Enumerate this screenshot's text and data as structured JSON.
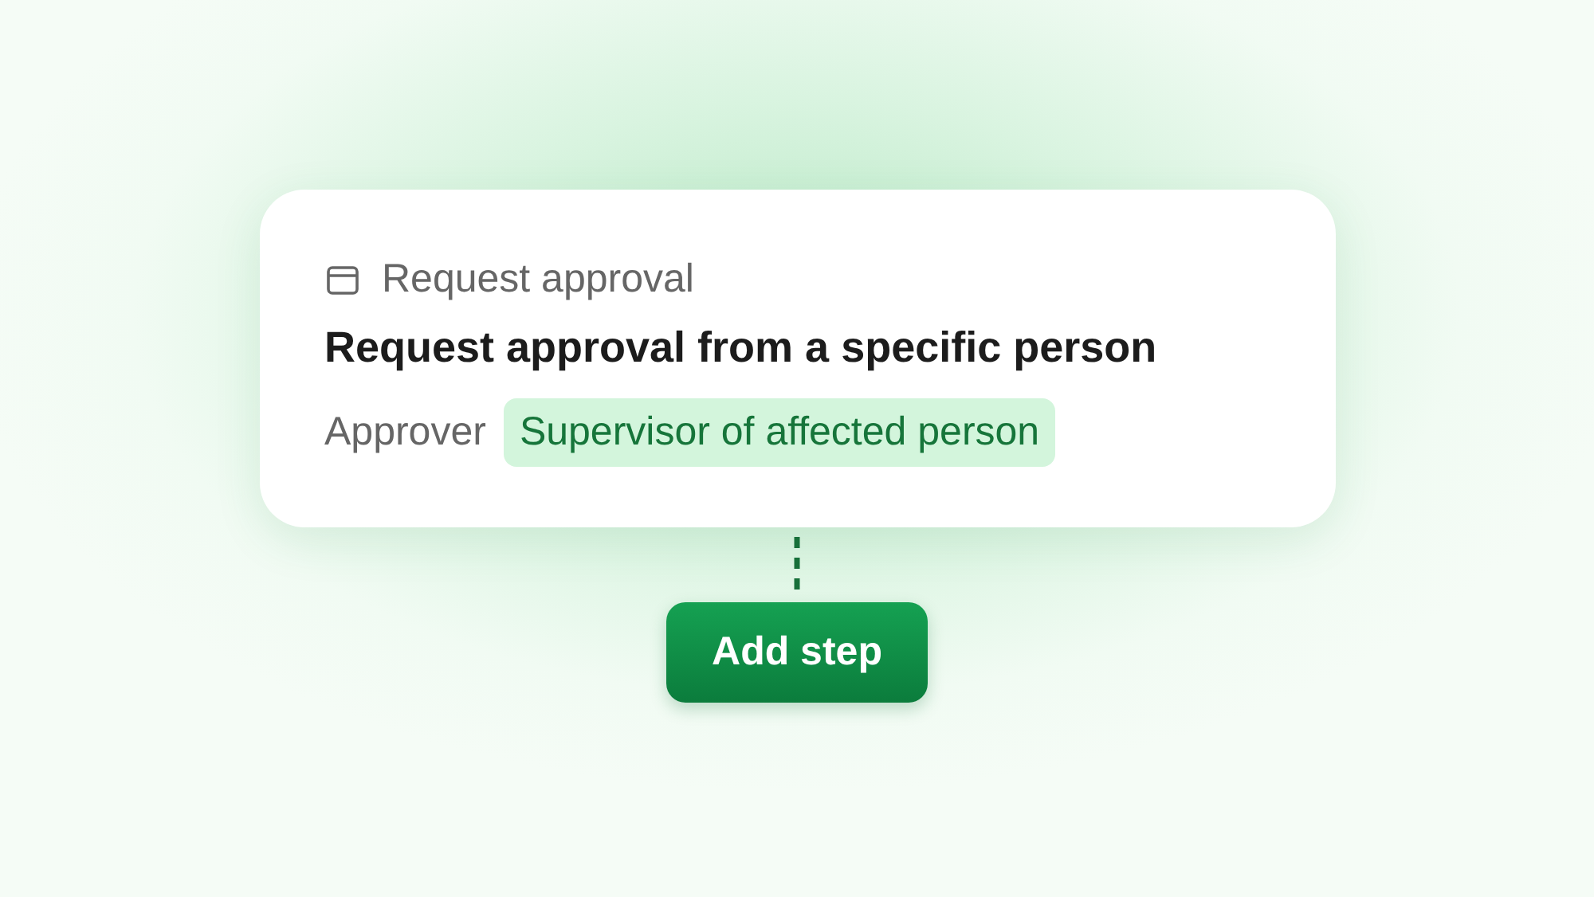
{
  "step_card": {
    "category": "Request approval",
    "title": "Request approval from a specific person",
    "field_label": "Approver",
    "field_value": "Supervisor of affected person"
  },
  "add_button": {
    "label": "Add step"
  }
}
